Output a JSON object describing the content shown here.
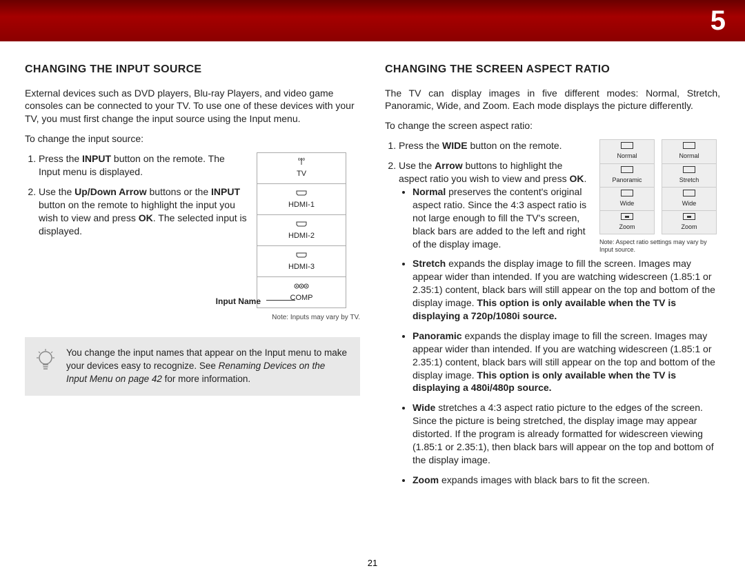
{
  "chapter_number": "5",
  "page_number": "21",
  "left": {
    "heading": "CHANGING THE INPUT SOURCE",
    "intro": "External devices such as DVD players, Blu-ray Players, and video game consoles can be connected to your TV. To use one of these devices with your TV, you must first change the input source using the Input menu.",
    "instruction_lead": "To change the input source:",
    "step1_a": "Press the ",
    "step1_b": "INPUT",
    "step1_c": " button on the remote. The Input menu is displayed.",
    "step2_a": "Use the ",
    "step2_b": "Up/Down Arrow",
    "step2_c": " buttons or the ",
    "step2_d": "INPUT",
    "step2_e": " button on the remote to highlight the input you wish to view and press ",
    "step2_f": "OK",
    "step2_g": ". The selected input is displayed.",
    "menu": {
      "item1": "TV",
      "item2": "HDMI-1",
      "item3": "HDMI-2",
      "item4": "HDMI-3",
      "item5": "COMP"
    },
    "label": "Input Name ",
    "note": "Note: Inputs may vary by TV.",
    "tip_a": "You change the input names that appear on the Input menu to make your devices easy to recognize. See ",
    "tip_b": "Renaming Devices on the Input Menu on page 42",
    "tip_c": " for more information."
  },
  "right": {
    "heading": "CHANGING THE SCREEN ASPECT RATIO",
    "intro": "The TV can display images in five different modes: Normal, Stretch, Panoramic, Wide, and Zoom. Each mode displays the picture differently.",
    "instruction_lead": "To change the screen aspect ratio:",
    "step1_a": "Press the ",
    "step1_b": "WIDE",
    "step1_c": " button on the remote.",
    "step2_a": "Use the ",
    "step2_b": "Arrow",
    "step2_c": " buttons to highlight the aspect ratio you wish to view and press ",
    "step2_d": "OK",
    "step2_e": ".",
    "aspect_left": {
      "r1": "Normal",
      "r2": "Panoramic",
      "r3": "Wide",
      "r4": "Zoom"
    },
    "aspect_right": {
      "r1": "Normal",
      "r2": "Stretch",
      "r3": "Wide",
      "r4": "Zoom"
    },
    "aspect_note": "Note: Aspect ratio settings may vary by Input source.",
    "normal_b": "Normal",
    "normal_t": " preserves the content's original aspect ratio. Since the 4:3 aspect ratio is not large enough to fill the TV's screen, black bars are added to the left and right of the display image.",
    "stretch_b": "Stretch",
    "stretch_t": " expands the display image to fill the screen. Images may appear wider than intended. If you are watching widescreen (1.85:1 or 2.35:1) content, black bars will still appear on the top and bottom of the display image. ",
    "stretch_b2": "This option is only available when the TV is displaying a 720p/1080i source.",
    "pano_b": "Panoramic",
    "pano_t": " expands the display image to fill the screen. Images may appear wider than intended. If you are watching widescreen (1.85:1 or 2.35:1) content, black bars will still appear on the top and bottom of the display image. ",
    "pano_b2": "This option is only available when the TV is displaying a 480i/480p source.",
    "wide_b": "Wide",
    "wide_t": " stretches a 4:3 aspect ratio picture to the edges of the screen. Since the picture is being stretched, the display image may appear distorted. If the program is already formatted for widescreen viewing (1.85:1 or 2.35:1), then black bars will appear on the top and bottom of the display image.",
    "zoom_b": "Zoom",
    "zoom_t": " expands images with black bars to fit the screen."
  }
}
